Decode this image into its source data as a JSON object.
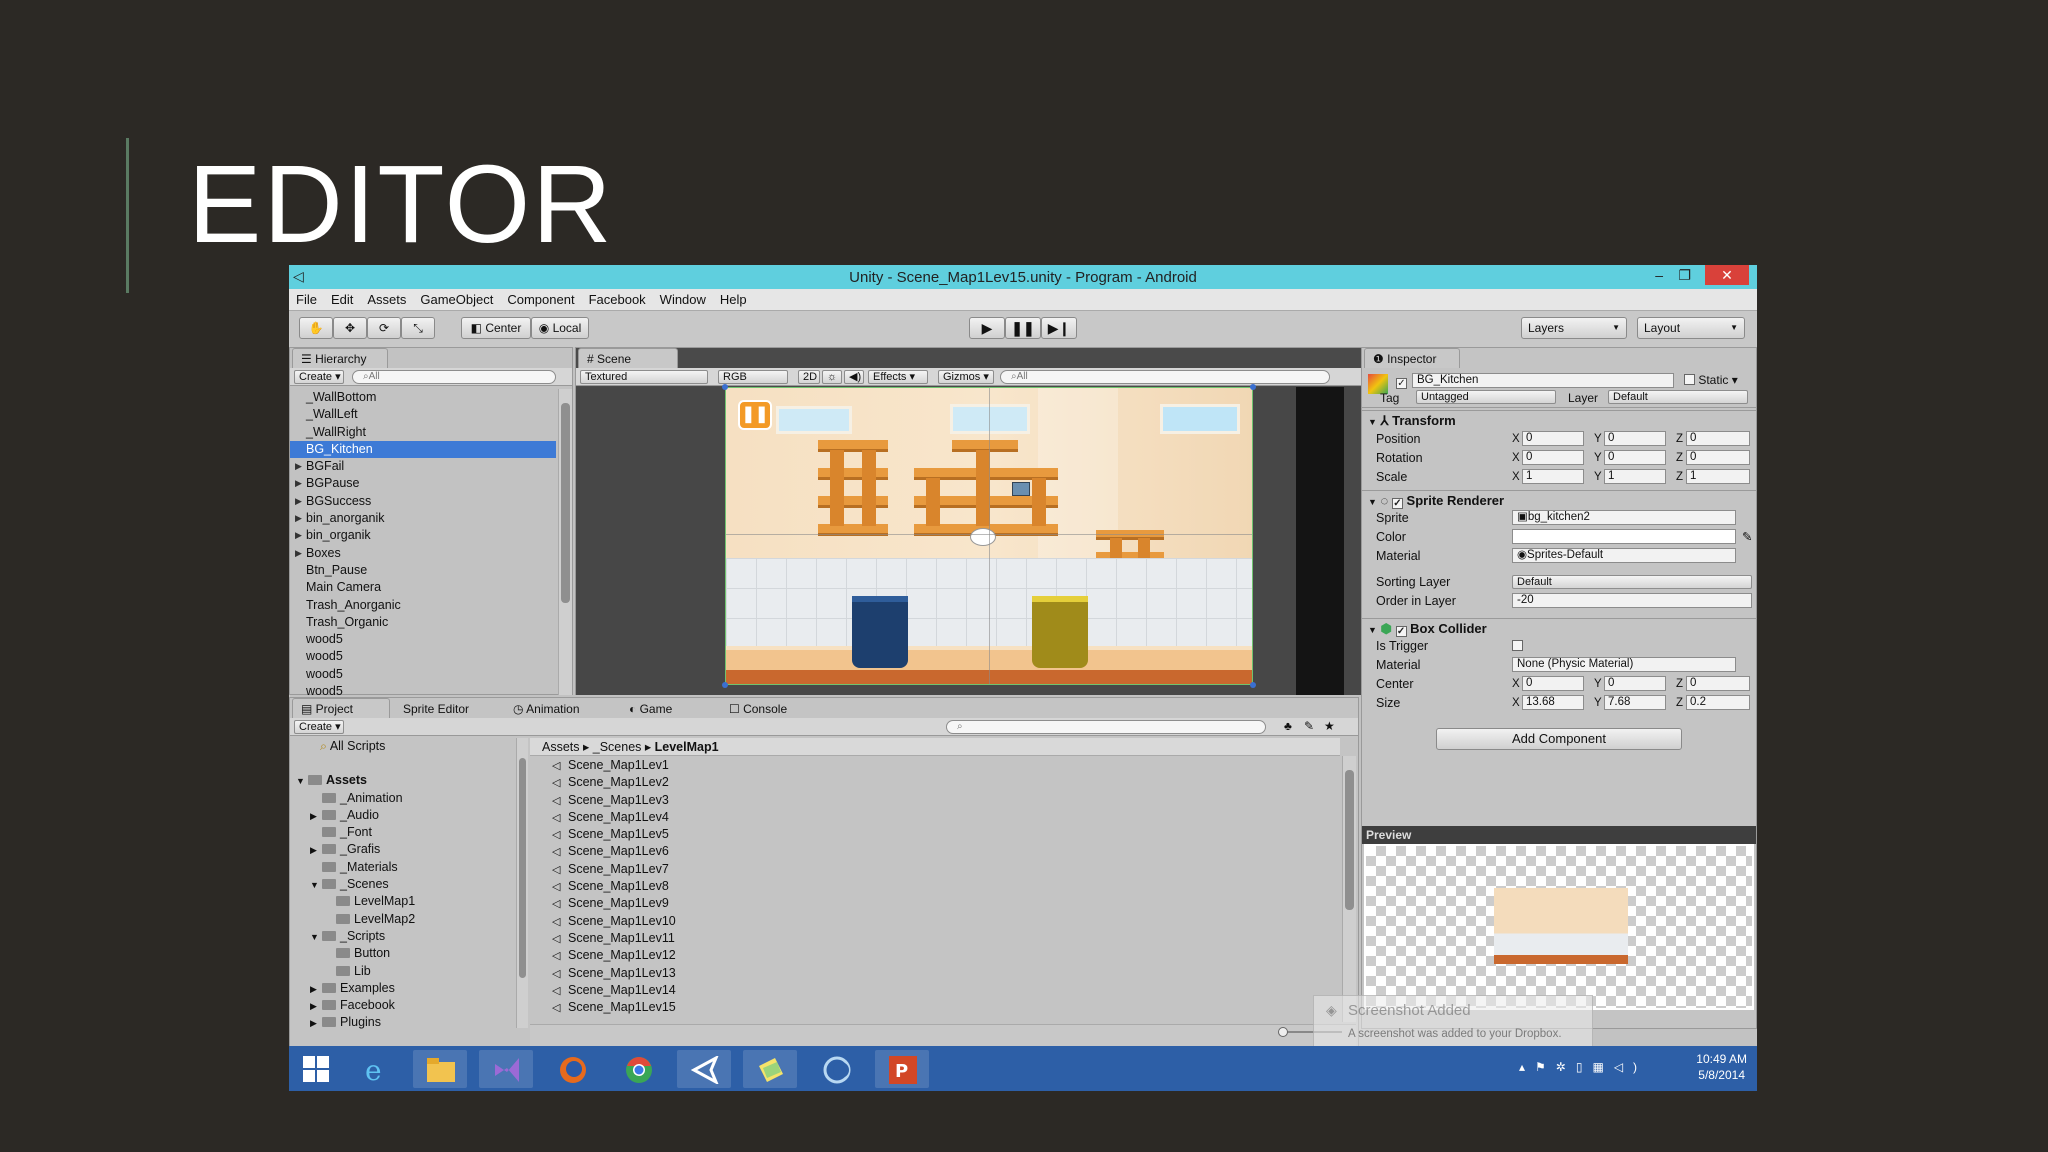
{
  "slide": {
    "title": "EDITOR"
  },
  "window": {
    "title": "Unity - Scene_Map1Lev15.unity - Program - Android",
    "minimize": "–",
    "maximize": "❐",
    "close": "✕"
  },
  "menu": [
    "File",
    "Edit",
    "Assets",
    "GameObject",
    "Component",
    "Facebook",
    "Window",
    "Help"
  ],
  "toolbar": {
    "pivot": "Center",
    "space": "Local",
    "layers": "Layers",
    "layout": "Layout"
  },
  "hierarchy": {
    "tab": "Hierarchy",
    "create": "Create",
    "search_placeholder": "All",
    "items": [
      {
        "label": "_WallBottom",
        "arrow": ""
      },
      {
        "label": "_WallLeft",
        "arrow": ""
      },
      {
        "label": "_WallRight",
        "arrow": ""
      },
      {
        "label": "BG_Kitchen",
        "arrow": "",
        "selected": true
      },
      {
        "label": "BGFail",
        "arrow": "▶"
      },
      {
        "label": "BGPause",
        "arrow": "▶"
      },
      {
        "label": "BGSuccess",
        "arrow": "▶"
      },
      {
        "label": "bin_anorganik",
        "arrow": "▶"
      },
      {
        "label": "bin_organik",
        "arrow": "▶"
      },
      {
        "label": "Boxes",
        "arrow": "▶"
      },
      {
        "label": "Btn_Pause",
        "arrow": ""
      },
      {
        "label": "Main Camera",
        "arrow": ""
      },
      {
        "label": "Trash_Anorganic",
        "arrow": ""
      },
      {
        "label": "Trash_Organic",
        "arrow": ""
      },
      {
        "label": "wood5",
        "arrow": ""
      },
      {
        "label": "wood5",
        "arrow": ""
      },
      {
        "label": "wood5",
        "arrow": ""
      },
      {
        "label": "wood5",
        "arrow": ""
      }
    ]
  },
  "scene": {
    "tab": "Scene",
    "render_mode": "Textured",
    "color_mode": "RGB",
    "mode_2d": "2D",
    "effects": "Effects",
    "gizmos": "Gizmos",
    "search_placeholder": "All"
  },
  "bottom_tabs": {
    "project": "Project",
    "sprite_editor": "Sprite Editor",
    "animation": "Animation",
    "game": "Game",
    "console": "Console"
  },
  "project": {
    "create": "Create",
    "favorites": "All Scripts",
    "tree": [
      {
        "label": "Assets",
        "depth": 0,
        "arrow": "▼",
        "bold": true
      },
      {
        "label": "_Animation",
        "depth": 1,
        "arrow": ""
      },
      {
        "label": "_Audio",
        "depth": 1,
        "arrow": "▶"
      },
      {
        "label": "_Font",
        "depth": 1,
        "arrow": ""
      },
      {
        "label": "_Grafis",
        "depth": 1,
        "arrow": "▶"
      },
      {
        "label": "_Materials",
        "depth": 1,
        "arrow": ""
      },
      {
        "label": "_Scenes",
        "depth": 1,
        "arrow": "▼"
      },
      {
        "label": "LevelMap1",
        "depth": 2,
        "arrow": ""
      },
      {
        "label": "LevelMap2",
        "depth": 2,
        "arrow": ""
      },
      {
        "label": "_Scripts",
        "depth": 1,
        "arrow": "▼"
      },
      {
        "label": "Button",
        "depth": 2,
        "arrow": ""
      },
      {
        "label": "Lib",
        "depth": 2,
        "arrow": ""
      },
      {
        "label": "Examples",
        "depth": 1,
        "arrow": "▶"
      },
      {
        "label": "Facebook",
        "depth": 1,
        "arrow": "▶"
      },
      {
        "label": "Plugins",
        "depth": 1,
        "arrow": "▶"
      }
    ],
    "breadcrumb": [
      "Assets",
      "_Scenes",
      "LevelMap1"
    ],
    "files": [
      "Scene_Map1Lev1",
      "Scene_Map1Lev2",
      "Scene_Map1Lev3",
      "Scene_Map1Lev4",
      "Scene_Map1Lev5",
      "Scene_Map1Lev6",
      "Scene_Map1Lev7",
      "Scene_Map1Lev8",
      "Scene_Map1Lev9",
      "Scene_Map1Lev10",
      "Scene_Map1Lev11",
      "Scene_Map1Lev12",
      "Scene_Map1Lev13",
      "Scene_Map1Lev14",
      "Scene_Map1Lev15"
    ]
  },
  "inspector": {
    "tab": "Inspector",
    "object_name": "BG_Kitchen",
    "static": "Static",
    "tag_label": "Tag",
    "tag": "Untagged",
    "layer_label": "Layer",
    "layer": "Default",
    "transform": {
      "title": "Transform",
      "rows": [
        {
          "label": "Position",
          "x": "0",
          "y": "0",
          "z": "0"
        },
        {
          "label": "Rotation",
          "x": "0",
          "y": "0",
          "z": "0"
        },
        {
          "label": "Scale",
          "x": "1",
          "y": "1",
          "z": "1"
        }
      ]
    },
    "sprite_renderer": {
      "title": "Sprite Renderer",
      "sprite_label": "Sprite",
      "sprite": "bg_kitchen2",
      "color_label": "Color",
      "material_label": "Material",
      "material": "Sprites-Default",
      "sorting_layer_label": "Sorting Layer",
      "sorting_layer": "Default",
      "order_label": "Order in Layer",
      "order": "-20"
    },
    "box_collider": {
      "title": "Box Collider",
      "trigger_label": "Is Trigger",
      "material_label": "Material",
      "material": "None (Physic Material)",
      "center_label": "Center",
      "center": {
        "x": "0",
        "y": "0",
        "z": "0"
      },
      "size_label": "Size",
      "size": {
        "x": "13.68",
        "y": "7.68",
        "z": "0.2"
      }
    },
    "add_component": "Add Component",
    "preview": "Preview"
  },
  "notification": {
    "title": "Screenshot Added",
    "body": "A screenshot was added to your Dropbox."
  },
  "taskbar": {
    "time": "10:49 AM",
    "date": "5/8/2014"
  }
}
